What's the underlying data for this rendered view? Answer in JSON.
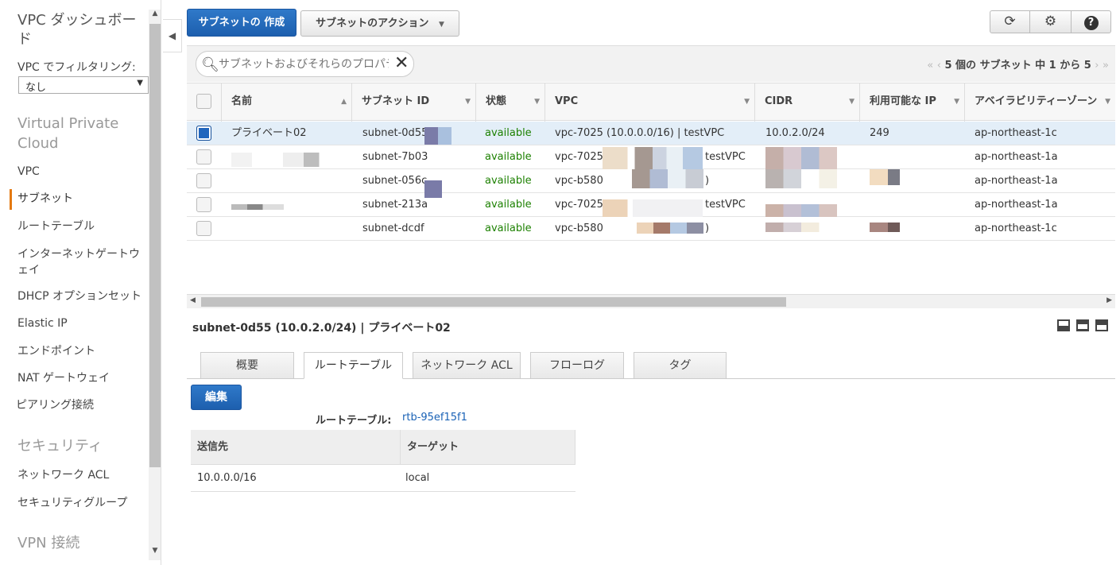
{
  "sidebar": {
    "title": "VPC ダッシュボード",
    "filter_label": "VPC でフィルタリング:",
    "filter_value": "なし",
    "sections": [
      {
        "title": "Virtual Private Cloud"
      },
      {
        "title": "セキュリティ"
      },
      {
        "title": "VPN 接続"
      }
    ],
    "items": [
      {
        "label": "VPC"
      },
      {
        "label": "サブネット"
      },
      {
        "label": "ルートテーブル"
      },
      {
        "label": "インターネットゲートウェイ"
      },
      {
        "label": "DHCP オプションセット"
      },
      {
        "label": "Elastic IP"
      },
      {
        "label": "エンドポイント"
      },
      {
        "label": "NAT ゲートウェイ"
      },
      {
        "label": "ピアリング接続"
      },
      {
        "label": "ネットワーク ACL"
      },
      {
        "label": "セキュリティグループ"
      }
    ],
    "active_item": "サブネット"
  },
  "toolbar": {
    "create_label": "サブネットの 作成",
    "actions_label": "サブネットのアクション",
    "icons": [
      "refresh-icon",
      "gear-icon",
      "help-icon"
    ]
  },
  "search": {
    "placeholder": "サブネットおよびそれらのプロパティでフィルター"
  },
  "pager": {
    "text": "5 個の サブネット 中 1 から 5"
  },
  "table": {
    "columns": [
      "名前",
      "サブネット ID",
      "状態",
      "VPC",
      "CIDR",
      "利用可能な IP",
      "アベイラビリティーゾーン"
    ],
    "rows": [
      {
        "name": "プライベート02",
        "subnet_id": "subnet-0d55",
        "state": "available",
        "vpc": "vpc-7025  (10.0.0.0/16) | testVPC",
        "cidr": "10.0.2.0/24",
        "ips": "249",
        "az": "ap-northeast-1c",
        "selected": true
      },
      {
        "name": "",
        "subnet_id": "subnet-7b03",
        "state": "available",
        "vpc": "vpc-7025",
        "vpc_tail": "testVPC",
        "cidr": "",
        "ips": "",
        "az": "ap-northeast-1a",
        "selected": false
      },
      {
        "name": "",
        "subnet_id": "subnet-056c",
        "state": "available",
        "vpc": "vpc-b580",
        "vpc_tail": ")",
        "cidr": "",
        "ips": "",
        "az": "ap-northeast-1a",
        "selected": false
      },
      {
        "name": "",
        "subnet_id": "subnet-213a",
        "state": "available",
        "vpc": "vpc-7025",
        "vpc_tail": "testVPC",
        "cidr": "",
        "ips": "",
        "az": "ap-northeast-1a",
        "selected": false
      },
      {
        "name": "",
        "subnet_id": "subnet-dcdf",
        "state": "available",
        "vpc": "vpc-b580",
        "vpc_tail": ")",
        "cidr": "",
        "ips": "",
        "az": "ap-northeast-1c",
        "selected": false
      }
    ]
  },
  "detail": {
    "title": "subnet-0d55 (10.0.2.0/24) | プライベート02",
    "tabs": [
      "概要",
      "ルートテーブル",
      "ネットワーク ACL",
      "フローログ",
      "タグ"
    ],
    "active_tab": "ルートテーブル",
    "edit_label": "編集",
    "route_table_label": "ルートテーブル:",
    "route_table_value": "rtb-95ef15f1",
    "route_columns": [
      "送信先",
      "ターゲット"
    ],
    "routes": [
      {
        "destination": "10.0.0.0/16",
        "target": "local"
      }
    ]
  },
  "colors": {
    "primary": "#1d5fae",
    "accent": "#e47911",
    "available": "#1d8102",
    "link": "#1a62b6"
  }
}
